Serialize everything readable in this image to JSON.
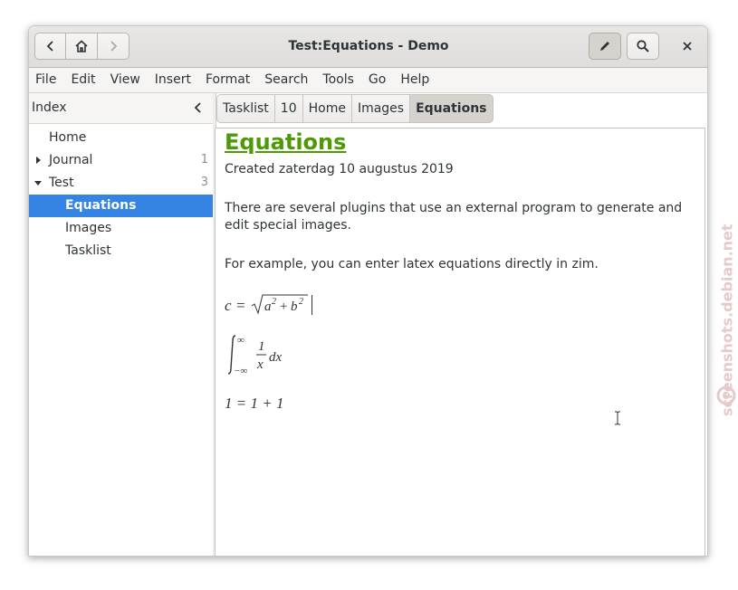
{
  "window": {
    "title": "Test:Equations - Demo"
  },
  "menubar": [
    "File",
    "Edit",
    "View",
    "Insert",
    "Format",
    "Search",
    "Tools",
    "Go",
    "Help"
  ],
  "sidebar": {
    "title": "Index",
    "items": [
      {
        "label": "Home",
        "count": "",
        "level": 0,
        "expander": ""
      },
      {
        "label": "Journal",
        "count": "1",
        "level": 0,
        "expander": "collapsed"
      },
      {
        "label": "Test",
        "count": "3",
        "level": 0,
        "expander": "expanded"
      },
      {
        "label": "Equations",
        "count": "",
        "level": 1,
        "expander": "",
        "selected": true
      },
      {
        "label": "Images",
        "count": "",
        "level": 1,
        "expander": ""
      },
      {
        "label": "Tasklist",
        "count": "",
        "level": 1,
        "expander": ""
      }
    ]
  },
  "pathbar": [
    "Tasklist",
    "10",
    "Home",
    "Images",
    "Equations"
  ],
  "page": {
    "heading": "Equations",
    "created": "Created zaterdag 10 augustus 2019",
    "para1": "There are several plugins that use an external program to generate and edit special images.",
    "para2": "For example, you can enter latex equations directly in zim.",
    "eq1": "c = √(a² + b²)",
    "eq2": "∫₋∞^∞ (1/x) dx",
    "eq3": "1 = 1 + 1"
  },
  "watermark": "screenshots.debian.net",
  "colors": {
    "heading": "#4e9a06",
    "selection": "#3584e4",
    "watermark": "#e7c9c9"
  }
}
